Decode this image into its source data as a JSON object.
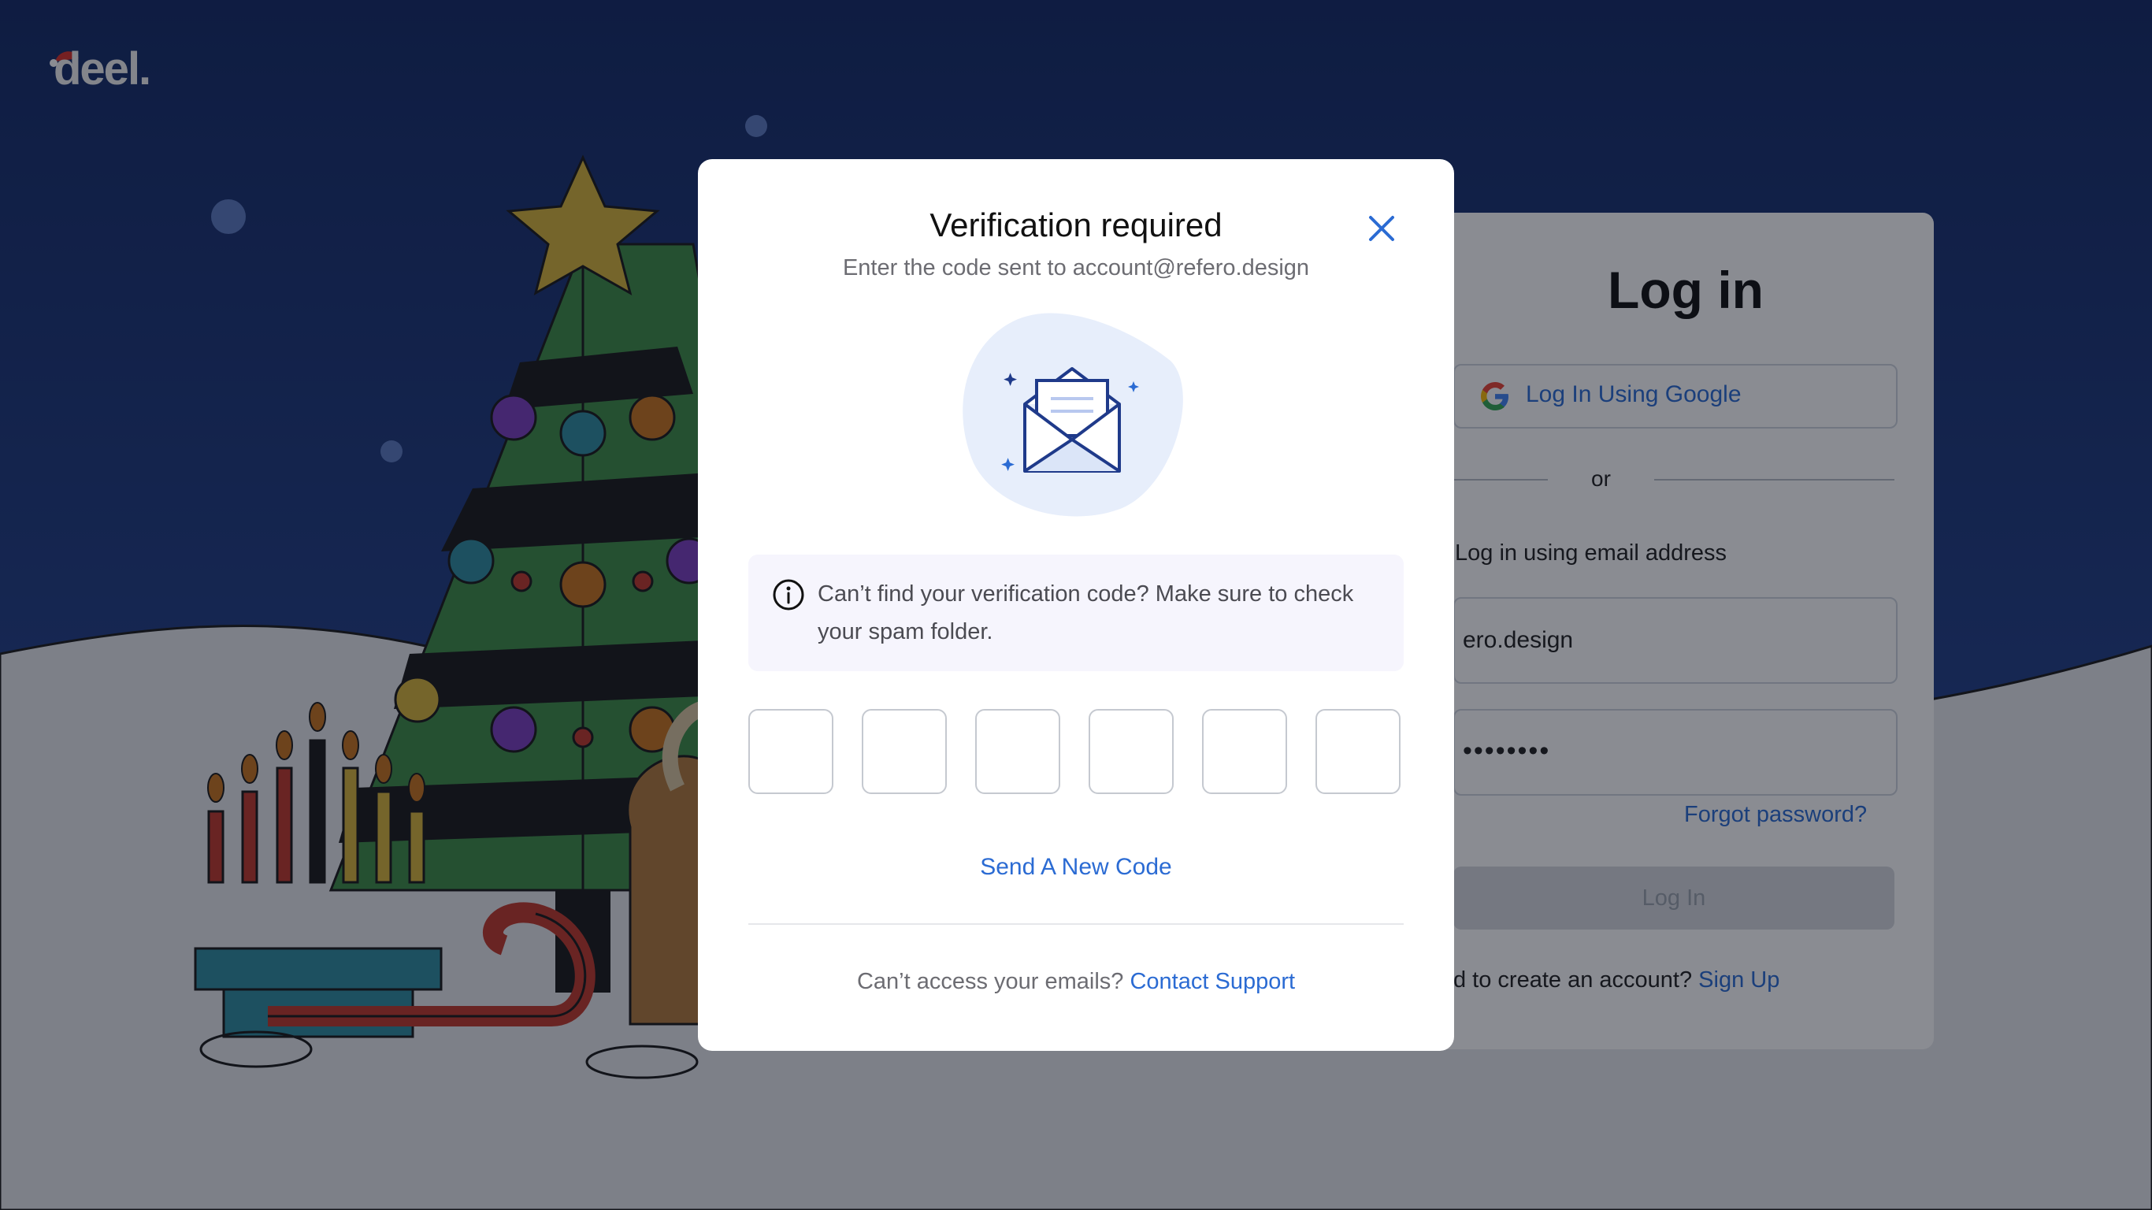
{
  "brand": {
    "logo_text": "deel."
  },
  "login_card": {
    "title": "Log in",
    "google_button_label": "Log In Using Google",
    "divider_text": "or",
    "email_section_label": "Log in using email address",
    "email_value": "ero.design",
    "password_value": "••••••••",
    "forgot_password_label": "Forgot password?",
    "login_button_label": "Log In",
    "signup_prompt": "d to create an account?",
    "signup_link": "Sign Up"
  },
  "modal": {
    "title": "Verification required",
    "subtitle": "Enter the code sent to account@refero.design",
    "illustration_icon": "open-envelope-icon",
    "notice_icon": "info-icon",
    "notice_text": "Can’t find your verification code? Make sure to check your spam folder.",
    "code_digits": [
      "",
      "",
      "",
      "",
      "",
      ""
    ],
    "resend_label": "Send A New Code",
    "support_prompt": "Can’t access your emails?",
    "support_link": "Contact Support",
    "close_icon": "close-icon"
  },
  "colors": {
    "accent": "#2b6bd3",
    "night_sky": "#0f2048",
    "snow": "#e6e8ec",
    "modal_bg": "#ffffff",
    "notice_bg": "#f6f5fd"
  }
}
